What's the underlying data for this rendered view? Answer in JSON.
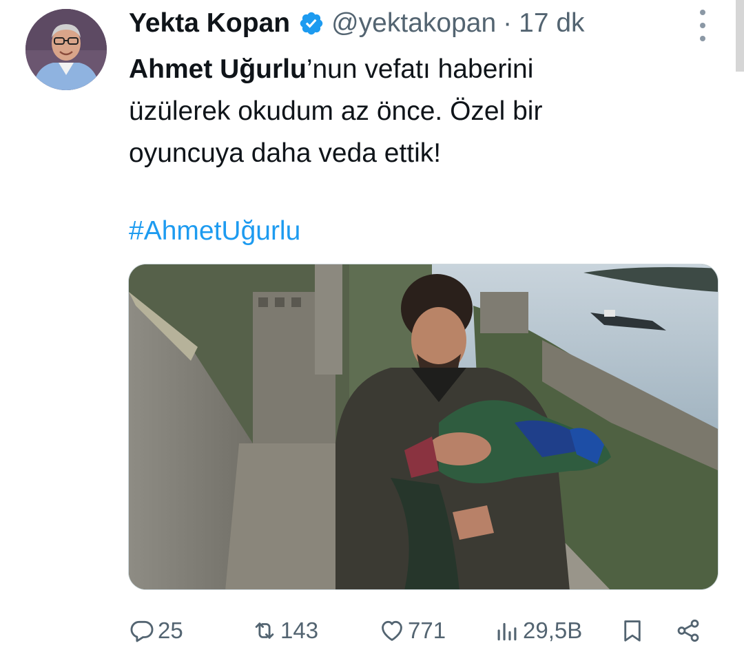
{
  "tweet": {
    "author_name": "Yekta Kopan",
    "handle": "@yektakopan",
    "separator": "·",
    "time": "17 dk",
    "text_bold": "Ahmet Uğurlu",
    "text_line1_rest": "’nun vefatı haberini",
    "text_line2": "üzülerek okudum az önce. Özel bir",
    "text_line3": "oyuncuya daha veda ettik!",
    "hashtag": "#AhmetUğurlu"
  },
  "actions": {
    "replies": "25",
    "retweets": "143",
    "likes": "771",
    "views": "29,5B"
  },
  "icons": {
    "verified": "verified-badge-icon",
    "more": "more-options-icon",
    "reply": "reply-icon",
    "retweet": "retweet-icon",
    "like": "heart-icon",
    "views": "views-chart-icon",
    "bookmark": "bookmark-icon",
    "share": "share-icon"
  },
  "colors": {
    "accent": "#1d9bf0",
    "secondary_text": "#536471",
    "primary_text": "#0f1419"
  }
}
